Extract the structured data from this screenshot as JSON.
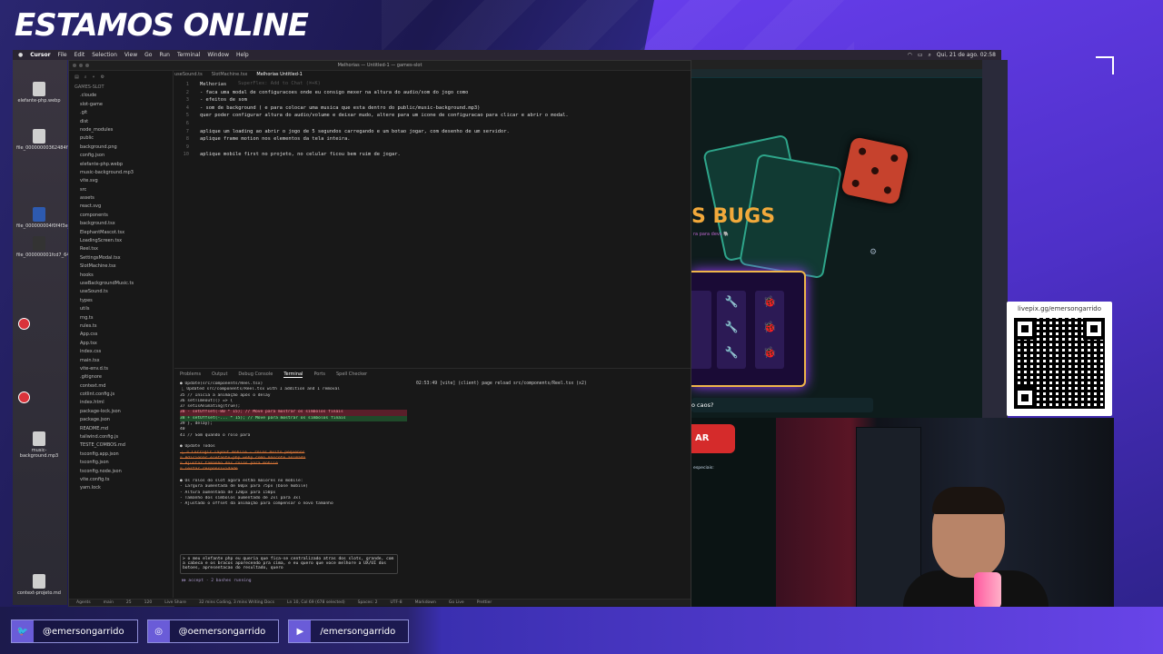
{
  "stream": {
    "title": "ESTAMOS ONLINE"
  },
  "menubar": {
    "app": "Cursor",
    "items": [
      "File",
      "Edit",
      "Selection",
      "View",
      "Go",
      "Run",
      "Terminal",
      "Window",
      "Help"
    ],
    "clock": "Qui, 21 de ago. 02:58"
  },
  "desktop": {
    "icons": [
      {
        "label": "elefante-php.webp"
      },
      {
        "label": "file_00000000362484f78_87.webp"
      },
      {
        "label": "file_000000004f0f4f3e_bf1ae..."
      },
      {
        "label": "file_000000001fcd7_64a..."
      },
      {
        "label": "music-background.mp3"
      },
      {
        "label": "context-projeto.md"
      }
    ]
  },
  "ide": {
    "window_title": "Melhorias — Untitled-1 — games-slot",
    "tabs": [
      {
        "label": "useSound.ts"
      },
      {
        "label": "SlotMachine.tsx"
      },
      {
        "label": "Melhorias Untitled-1",
        "active": true
      }
    ],
    "explorer": {
      "root": "GAMES-SLOT",
      "items": [
        ".cloude",
        "slot-game",
        ".git",
        "dist",
        "node_modules",
        "public",
        "background.png",
        "config.json",
        "elefante-php.webp",
        "music-background.mp3",
        "vite.svg",
        "src",
        "assets",
        "react.svg",
        "components",
        "background.tsx",
        "ElephantMascot.tsx",
        "LoadingScreen.tsx",
        "Reel.tsx",
        "SettingsModal.tsx",
        "SlotMachine.tsx",
        "hooks",
        "useBackgroundMusic.ts",
        "useSound.ts",
        "types",
        "utils",
        "rng.ts",
        "rules.ts",
        "App.css",
        "App.tsx",
        "index.css",
        "main.tsx",
        "vite-env.d.ts",
        ".gitignore",
        "context.md",
        "cotlint.config.js",
        "index.html",
        "package-lock.json",
        "package.json",
        "README.md",
        "tailwind.config.js",
        "TESTE_COMBOS.md",
        "tsconfig.app.json",
        "tsconfig.json",
        "tsconfig.node.json",
        "vite.config.ts",
        "yarn.lock"
      ],
      "footer": [
        "OUTLINE",
        "TIMELINE"
      ]
    },
    "editor_lines": [
      {
        "n": "1",
        "t": "Melhorias"
      },
      {
        "n": "2",
        "t": "- faca uma modal de configuracoes onde eu consigo mexer na altura do audio/som do jogo como"
      },
      {
        "n": "3",
        "t": "- efeitos de som"
      },
      {
        "n": "4",
        "t": "- som de background ( e para colocar uma musica que esta dentro do public/music-background.mp3)"
      },
      {
        "n": "5",
        "t": "quer poder configurar altura do audio/volume e deixar mudo, altere para um icone de configuracao para clicar e abrir o modal."
      },
      {
        "n": "6",
        "t": ""
      },
      {
        "n": "7",
        "t": "aplique um loading ao abrir o jogo de 5 segundos carregando e um botao jogar, com desenho de um servidor."
      },
      {
        "n": "8",
        "t": "aplique frame motion nos elementos da tela inteira."
      },
      {
        "n": "9",
        "t": ""
      },
      {
        "n": "10",
        "t": "aplique mobile first no projeto, no celular ficou bem ruim de jogar."
      }
    ],
    "editor_hint": "SuperFlex: Add to Chat (⌘+K)",
    "panel_tabs": [
      "Problems",
      "Output",
      "Debug Console",
      "Terminal",
      "Ports",
      "Spell Checker"
    ],
    "terminal_left": [
      {
        "t": "● Update(src/components/Reel.tsx)",
        "c": ""
      },
      {
        "t": "  ⎿ Updated src/components/Reel.tsx with 1 addition and 1 removal",
        "c": ""
      },
      {
        "t": "     35        // Inicia a animação após o delay",
        "c": ""
      },
      {
        "t": "     36        setTimeout(() => {",
        "c": ""
      },
      {
        "t": "     37          setIsAnimating(true);",
        "c": ""
      },
      {
        "t": "     38 -        setOffset(-80 * 15); // Move para mostrar os símbolos finais",
        "c": "del"
      },
      {
        "t": "     38 +        setOffset(-... * 15); // Move para mostrar os símbolos finais",
        "c": "add"
      },
      {
        "t": "     39        }, delay);",
        "c": ""
      },
      {
        "t": "     40",
        "c": ""
      },
      {
        "t": "     41        // Som quando o rolo para",
        "c": ""
      },
      {
        "t": "",
        "c": ""
      },
      {
        "t": "● Update Todos",
        "c": ""
      },
      {
        "t": "  ⎿ ☒ Corrigir layout mobile - rolos muito pequenos",
        "c": "strike"
      },
      {
        "t": "     ☒ Adicionar elefante-php.webp como mascote animado",
        "c": "strike"
      },
      {
        "t": "     ☒ Ajustar tamanho dos rolos para mobile",
        "c": "strike"
      },
      {
        "t": "     ☒ Testar responsividade",
        "c": "strike"
      },
      {
        "t": "",
        "c": ""
      },
      {
        "t": "● Os rolos do slot agora estão maiores no mobile:",
        "c": ""
      },
      {
        "t": "  - Largura aumentada de 60px para 75px (base mobile)",
        "c": ""
      },
      {
        "t": "  - Altura aumentada de 120px para 150px",
        "c": ""
      },
      {
        "t": "  - Tamanho dos símbolos aumentado de 2xl para 3xl",
        "c": ""
      },
      {
        "t": "  - Ajustado o offset da animação para compensar o novo tamanho",
        "c": ""
      }
    ],
    "terminal_right": "02:53:49 [vite] (client) page reload src/components/Reel.tsx (x2)",
    "prompt_text": "> o meu elefante php eu queria que fica-se centralizado atras dos slots, grande, com a cabeca e os bracos aparecendo pra cima, e eu quero que voce melhore a UX/UI dos botoes, apresentacao do resultado, quero",
    "prompt_footer": "⏵⏵ accept · 2 bashes running",
    "statusbar": [
      "Agents",
      "main",
      "25",
      "120",
      "Live Share",
      "32 mins Coding, 3 mins Writing Docs",
      "Ln 10, Col 69 (678 selected)",
      "Spaces: 2",
      "UTF-8",
      "Markdown",
      "Go Live",
      "Prettier"
    ]
  },
  "game": {
    "title_fragment": "S BUGS",
    "subtitle_fragment": "ra para devs 🐘",
    "question_fragment": "o caos?",
    "button_fragment": "AR",
    "specials_label": "especiais:",
    "reel_symbols": [
      "🐞",
      "🐞",
      "🐞"
    ]
  },
  "livepix": {
    "label": "livepix.gg/emersongarrido"
  },
  "socials": [
    {
      "icon": "twitter-icon",
      "glyph": "🐦",
      "handle": "@emersongarrido"
    },
    {
      "icon": "instagram-icon",
      "glyph": "◎",
      "handle": "@oemersongarrido"
    },
    {
      "icon": "youtube-icon",
      "glyph": "▶",
      "handle": "/emersongarrido"
    }
  ]
}
